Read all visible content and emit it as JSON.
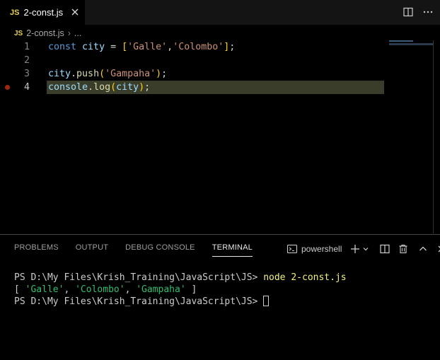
{
  "tab": {
    "lang_badge": "JS",
    "name": "2-const.js"
  },
  "breadcrumb": {
    "lang_badge": "JS",
    "file": "2-const.js",
    "sep": "›",
    "more": "..."
  },
  "editor": {
    "lines": [
      {
        "num": "1"
      },
      {
        "num": "2"
      },
      {
        "num": "3"
      },
      {
        "num": "4"
      }
    ],
    "tokens": {
      "l1_kw": "const",
      "l1_var": "city",
      "l1_eq": " = ",
      "l1_open": "[",
      "l1_s1": "'Galle'",
      "l1_comma": ",",
      "l1_s2": "'Colombo'",
      "l1_close": "]",
      "l1_semi": ";",
      "l3_var": "city",
      "l3_dot": ".",
      "l3_fn": "push",
      "l3_open": "(",
      "l3_s": "'Gampaha'",
      "l3_close": ")",
      "l3_semi": ";",
      "l4_var": "console",
      "l4_dot": ".",
      "l4_fn": "log",
      "l4_open": "(",
      "l4_arg": "city",
      "l4_close": ")",
      "l4_semi": ";"
    }
  },
  "panel": {
    "tabs": [
      "PROBLEMS",
      "OUTPUT",
      "DEBUG CONSOLE",
      "TERMINAL"
    ],
    "shell": "powershell",
    "terminal": {
      "prompt1": "PS D:\\My Files\\Krish_Training\\JavaScript\\JS> ",
      "command": "node 2-const.js",
      "out_open": "[ ",
      "out_s1": "'Galle'",
      "out_c1": ", ",
      "out_s2": "'Colombo'",
      "out_c2": ", ",
      "out_s3": "'Gampaha'",
      "out_close": " ]",
      "prompt2": "PS D:\\My Files\\Krish_Training\\JavaScript\\JS> "
    }
  },
  "colors": {
    "keyword": "#569cd6",
    "variable": "#9cdcfe",
    "function": "#dcdcaa",
    "string": "#ce9178",
    "line_highlight": "#3a3d2a",
    "breakpoint": "#a1260d"
  },
  "icons": [
    "close-icon",
    "split-editor-icon",
    "more-icon",
    "terminal-icon",
    "plus-icon",
    "chevron-down-icon",
    "split-terminal-icon",
    "trash-icon",
    "chevron-up-icon"
  ]
}
